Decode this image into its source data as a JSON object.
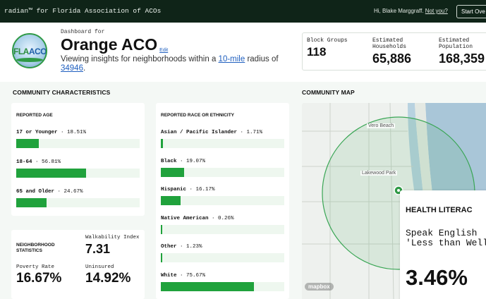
{
  "topbar": {
    "brand": "radian™ for Florida Association of ACOs",
    "greeting": "Hi, Blake Marggraff.",
    "not_you": "Not you?",
    "start_button": "Start Ove"
  },
  "header": {
    "logo_text_fla": "FLA",
    "logo_text_acos": "ACOs",
    "dashboard_for": "Dashboard for",
    "org_name": "Orange ACO",
    "edit_label": "Edit",
    "viewing_prefix": "Viewing insights for neighborhoods within a ",
    "radius": "10-mile",
    "viewing_middle": " radius of ",
    "zip": "34946",
    "viewing_suffix": "."
  },
  "summary_stats": [
    {
      "label": "Block Groups",
      "value": "118"
    },
    {
      "label": "Estimated Households",
      "value": "65,886"
    },
    {
      "label": "Estimated Population",
      "value": "168,359"
    }
  ],
  "sections": {
    "community_characteristics": "COMMUNITY CHARACTERISTICS",
    "community_map": "COMMUNITY MAP"
  },
  "age_card": {
    "title": "REPORTED AGE",
    "rows": [
      {
        "label": "17 or Younger",
        "value": "18.51%",
        "fraction": 0.1851
      },
      {
        "label": "18-64",
        "value": "56.81%",
        "fraction": 0.5681
      },
      {
        "label": "65 and Older",
        "value": "24.67%",
        "fraction": 0.2467
      }
    ]
  },
  "race_card": {
    "title": "REPORTED RACE OR ETHNICITY",
    "rows": [
      {
        "label": "Asian / Pacific Islander",
        "value": "1.71%",
        "fraction": 0.0171
      },
      {
        "label": "Black",
        "value": "19.07%",
        "fraction": 0.1907
      },
      {
        "label": "Hispanic",
        "value": "16.17%",
        "fraction": 0.1617
      },
      {
        "label": "Native American",
        "value": "0.26%",
        "fraction": 0.0026
      },
      {
        "label": "Other",
        "value": "1.23%",
        "fraction": 0.0123
      },
      {
        "label": "White",
        "value": "75.67%",
        "fraction": 0.7567
      }
    ]
  },
  "neighborhood": {
    "title": "NEIGHBORHOOD STATISTICS",
    "walkability_label": "Walkability Index",
    "walkability_value": "7.31",
    "poverty_label": "Poverty Rate",
    "poverty_value": "16.67%",
    "uninsured_label": "Uninsured",
    "uninsured_value": "14.92%"
  },
  "map": {
    "labels": [
      "Vero Beach",
      "Lakewood Park"
    ],
    "attribution": "mapbox",
    "colors": {
      "radius": "#3aa655",
      "water": "#a9c6d8",
      "land": "#eef1ee"
    }
  },
  "health_card": {
    "title": "HEALTH LITERAC",
    "description": "Speak English 'Less than Well'",
    "value": "3.46%"
  },
  "colors": {
    "topbar": "#0f2418",
    "bar_fill": "#20a23c",
    "bar_track": "#eef7ef",
    "link": "#1f5fbf"
  }
}
